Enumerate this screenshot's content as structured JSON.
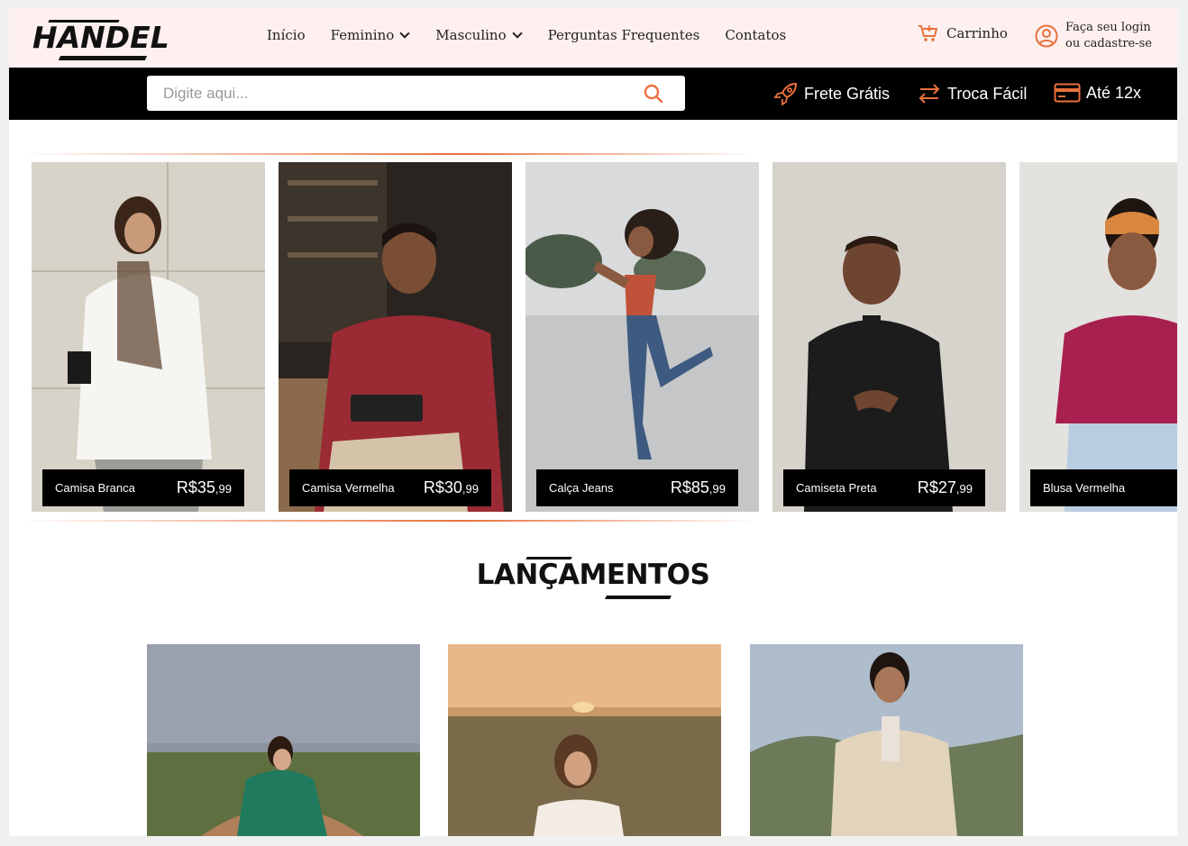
{
  "brand": {
    "logo_text": "HANDEL"
  },
  "nav": {
    "items": [
      {
        "label": "Início"
      },
      {
        "label": "Feminino"
      },
      {
        "label": "Masculino"
      },
      {
        "label": "Perguntas Frequentes"
      },
      {
        "label": "Contatos"
      }
    ]
  },
  "header": {
    "cart_label": "Carrinho",
    "login_line1": "Faça seu login",
    "login_line2": "ou cadastre-se"
  },
  "search": {
    "placeholder": "Digite aqui..."
  },
  "perks": {
    "shipping": "Frete Grátis",
    "exchange": "Troca Fácil",
    "installments": "Até 12x"
  },
  "products": [
    {
      "name": "Camisa Branca",
      "price": "R$35",
      "cents": ",99"
    },
    {
      "name": "Camisa Vermelha",
      "price": "R$30",
      "cents": ",99"
    },
    {
      "name": "Calça Jeans",
      "price": "R$85",
      "cents": ",99"
    },
    {
      "name": "Camiseta Preta",
      "price": "R$27",
      "cents": ",99"
    },
    {
      "name": "Blusa Vermelha",
      "price": "R",
      "cents": ""
    }
  ],
  "launches": {
    "title": "LANÇAMENTOS"
  },
  "colors": {
    "accent": "#e9703c",
    "header_bg": "#fdf0ee",
    "bar_bg": "#000000"
  },
  "icons": [
    "cart-icon",
    "user-icon",
    "search-icon",
    "rocket-icon",
    "exchange-icon",
    "card-icon",
    "chevron-down-icon"
  ]
}
